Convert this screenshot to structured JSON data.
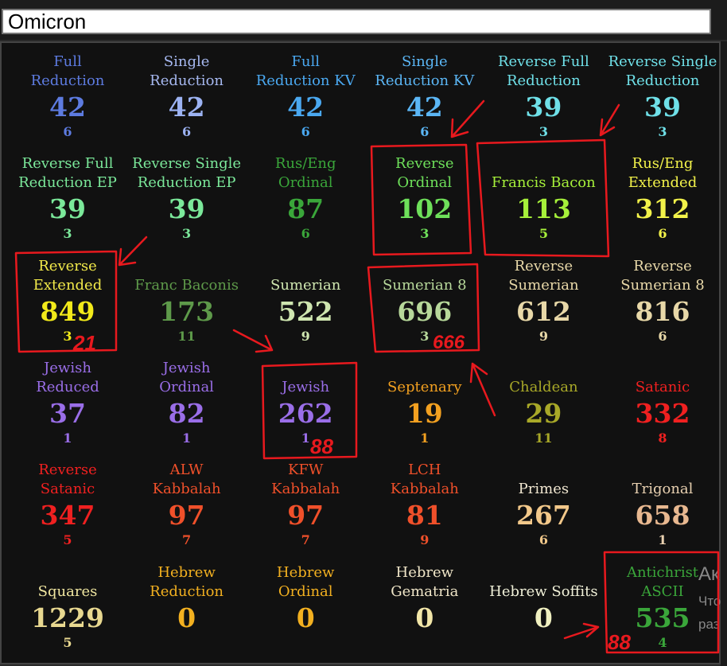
{
  "search": {
    "value": "Omicron"
  },
  "ciphers": [
    {
      "label": "Full\nReduction",
      "value": "42",
      "sub": "6",
      "label_color": "#5d7be0",
      "value_color": "#5d7be0",
      "sub_color": "#5d7be0"
    },
    {
      "label": "Single\nReduction",
      "value": "42",
      "sub": "6",
      "label_color": "#a6b8f0",
      "value_color": "#9cb2f2",
      "sub_color": "#9cb2f2"
    },
    {
      "label": "Full\nReduction KV",
      "value": "42",
      "sub": "6",
      "label_color": "#4aa8f0",
      "value_color": "#4aa8f0",
      "sub_color": "#4aa8f0"
    },
    {
      "label": "Single\nReduction KV",
      "value": "42",
      "sub": "6",
      "label_color": "#5bb6f5",
      "value_color": "#5bb6f5",
      "sub_color": "#5bb6f5"
    },
    {
      "label": "Reverse Full\nReduction",
      "value": "39",
      "sub": "3",
      "label_color": "#6fe0e8",
      "value_color": "#6fe0e8",
      "sub_color": "#6fe0e8"
    },
    {
      "label": "Reverse Single\nReduction",
      "value": "39",
      "sub": "3",
      "label_color": "#6fe0e8",
      "value_color": "#6fe0e8",
      "sub_color": "#6fe0e8"
    },
    {
      "label": "Reverse Full\nReduction EP",
      "value": "39",
      "sub": "3",
      "label_color": "#7be89a",
      "value_color": "#7be89a",
      "sub_color": "#7be89a"
    },
    {
      "label": "Reverse Single\nReduction EP",
      "value": "39",
      "sub": "3",
      "label_color": "#7be89a",
      "value_color": "#7be89a",
      "sub_color": "#7be89a"
    },
    {
      "label": "Rus/Eng\nOrdinal",
      "value": "87",
      "sub": "6",
      "label_color": "#3aa63a",
      "value_color": "#3aa63a",
      "sub_color": "#3aa63a"
    },
    {
      "label": "Reverse\nOrdinal",
      "value": "102",
      "sub": "3",
      "label_color": "#6ee05a",
      "value_color": "#6ee05a",
      "sub_color": "#6ee05a"
    },
    {
      "label": "Francis Bacon",
      "value": "113",
      "sub": "5",
      "label_color": "#a6f03a",
      "value_color": "#a6f03a",
      "sub_color": "#a6f03a"
    },
    {
      "label": "Rus/Eng\nExtended",
      "value": "312",
      "sub": "6",
      "label_color": "#f2f24a",
      "value_color": "#f2f24a",
      "sub_color": "#f2f24a"
    },
    {
      "label": "Reverse\nExtended",
      "value": "849",
      "sub": "3",
      "label_color": "#f2ea4a",
      "value_color": "#f2ea1a",
      "sub_color": "#f2ea1a"
    },
    {
      "label": "Franc Baconis",
      "value": "173",
      "sub": "11",
      "label_color": "#5e9a4a",
      "value_color": "#5e9a4a",
      "sub_color": "#5e9a4a"
    },
    {
      "label": "Sumerian",
      "value": "522",
      "sub": "9",
      "label_color": "#cfe6b0",
      "value_color": "#cfe6b0",
      "sub_color": "#cfe6b0"
    },
    {
      "label": "Sumerian 8",
      "value": "696",
      "sub": "3",
      "label_color": "#b7d89a",
      "value_color": "#b7d89a",
      "sub_color": "#b7d89a"
    },
    {
      "label": "Reverse\nSumerian",
      "value": "612",
      "sub": "9",
      "label_color": "#e8d8a8",
      "value_color": "#e8d8a8",
      "sub_color": "#e8d8a8"
    },
    {
      "label": "Reverse\nSumerian 8",
      "value": "816",
      "sub": "6",
      "label_color": "#e8d8a8",
      "value_color": "#e8d8a8",
      "sub_color": "#e8d8a8"
    },
    {
      "label": "Jewish\nReduced",
      "value": "37",
      "sub": "1",
      "label_color": "#9a6ee8",
      "value_color": "#9a6ee8",
      "sub_color": "#9a6ee8"
    },
    {
      "label": "Jewish\nOrdinal",
      "value": "82",
      "sub": "1",
      "label_color": "#9a6ee8",
      "value_color": "#9a6ee8",
      "sub_color": "#9a6ee8"
    },
    {
      "label": "Jewish",
      "value": "262",
      "sub": "1",
      "label_color": "#9a6ee8",
      "value_color": "#9a6ee8",
      "sub_color": "#9a6ee8"
    },
    {
      "label": "Septenary",
      "value": "19",
      "sub": "1",
      "label_color": "#f2a020",
      "value_color": "#f2a020",
      "sub_color": "#f2a020"
    },
    {
      "label": "Chaldean",
      "value": "29",
      "sub": "11",
      "label_color": "#a8a828",
      "value_color": "#a8a828",
      "sub_color": "#a8a828"
    },
    {
      "label": "Satanic",
      "value": "332",
      "sub": "8",
      "label_color": "#f02020",
      "value_color": "#f02020",
      "sub_color": "#f02020"
    },
    {
      "label": "Reverse\nSatanic",
      "value": "347",
      "sub": "5",
      "label_color": "#f02020",
      "value_color": "#f02020",
      "sub_color": "#f02020"
    },
    {
      "label": "ALW\nKabbalah",
      "value": "97",
      "sub": "7",
      "label_color": "#f0502a",
      "value_color": "#f0502a",
      "sub_color": "#f0502a"
    },
    {
      "label": "KFW\nKabbalah",
      "value": "97",
      "sub": "7",
      "label_color": "#f0502a",
      "value_color": "#f0502a",
      "sub_color": "#f0502a"
    },
    {
      "label": "LCH\nKabbalah",
      "value": "81",
      "sub": "9",
      "label_color": "#f0502a",
      "value_color": "#f0502a",
      "sub_color": "#f0502a"
    },
    {
      "label": "Primes",
      "value": "267",
      "sub": "6",
      "label_color": "#f0e6d0",
      "value_color": "#f2c88a",
      "sub_color": "#f2c88a"
    },
    {
      "label": "Trigonal",
      "value": "658",
      "sub": "1",
      "label_color": "#e8d0b0",
      "value_color": "#e8b890",
      "sub_color": "#e8d0b0"
    },
    {
      "label": "Squares",
      "value": "1229",
      "sub": "5",
      "label_color": "#f0e6a0",
      "value_color": "#e8d890",
      "sub_color": "#e8d890"
    },
    {
      "label": "Hebrew\nReduction",
      "value": "0",
      "sub": "",
      "label_color": "#f2b020",
      "value_color": "#f2b020",
      "sub_color": "#f2b020"
    },
    {
      "label": "Hebrew\nOrdinal",
      "value": "0",
      "sub": "",
      "label_color": "#f2b020",
      "value_color": "#f2b020",
      "sub_color": "#f2b020"
    },
    {
      "label": "Hebrew\nGematria",
      "value": "0",
      "sub": "",
      "label_color": "#f0e6c8",
      "value_color": "#f2e6a8",
      "sub_color": "#f2e6a8"
    },
    {
      "label": "Hebrew Soffits",
      "value": "0",
      "sub": "",
      "label_color": "#f0f0d8",
      "value_color": "#f0f0c0",
      "sub_color": "#f0f0c0"
    },
    {
      "label": "Antichrist\nASCII",
      "value": "535",
      "sub": "4",
      "label_color": "#3aa63a",
      "value_color": "#3aa63a",
      "sub_color": "#3aa63a"
    }
  ],
  "annotations": {
    "ink_color": "#e8191e",
    "marks": [
      "21",
      "666",
      "88",
      "88"
    ]
  },
  "side_text": [
    "Ак",
    "Что",
    "раз"
  ]
}
